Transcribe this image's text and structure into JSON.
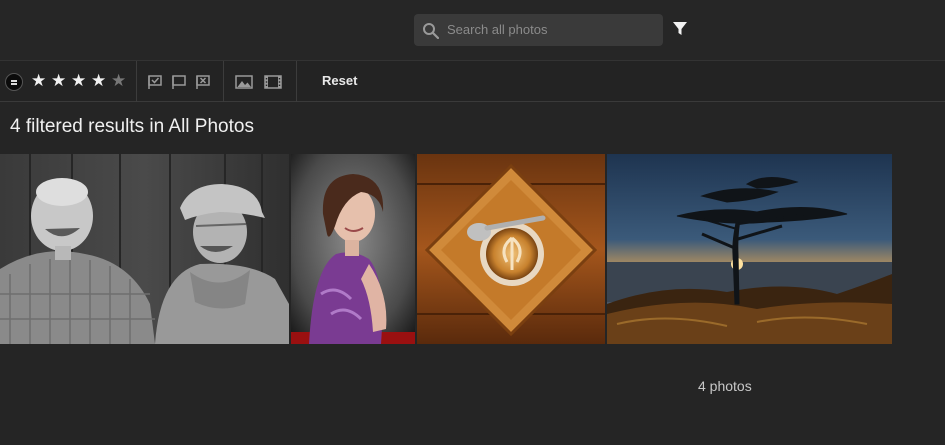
{
  "search": {
    "placeholder": "Search all photos",
    "icon": "search-icon"
  },
  "filter": {
    "icon": "funnel-icon"
  },
  "toolbar": {
    "rating_compare_icon": "equals-icon",
    "stars": {
      "total": 5,
      "filled": 4
    },
    "flag_icons": [
      "picked-flag-icon",
      "unflagged-icon",
      "rejected-flag-icon"
    ],
    "type_icons": [
      "photo-type-icon",
      "video-type-icon"
    ],
    "reset_label": "Reset"
  },
  "results": {
    "title": "4 filtered results in All Photos"
  },
  "photos": [
    {
      "subject": "two men laughing"
    },
    {
      "subject": "girl portrait"
    },
    {
      "subject": "latte on wooden plate"
    },
    {
      "subject": "tree at sunset"
    }
  ],
  "footer": {
    "count_label": "4 photos"
  },
  "colors": {
    "background": "#252525",
    "search_bg": "#3a3a3a",
    "text": "#e8e8e8"
  }
}
